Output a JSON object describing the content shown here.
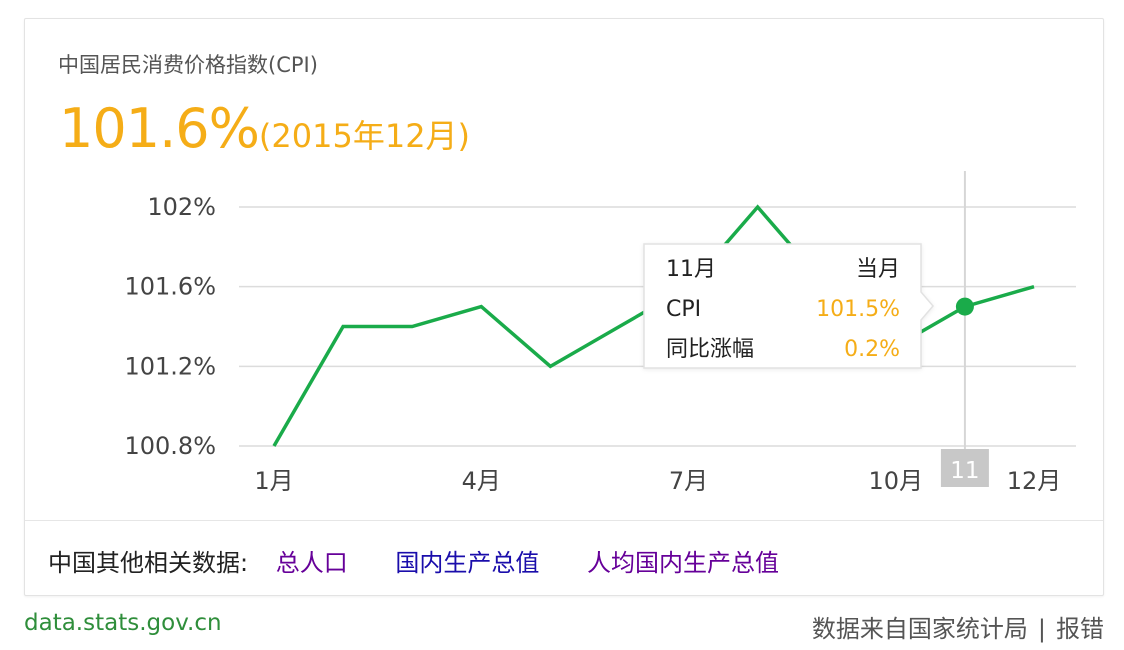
{
  "card": {
    "title": "中国居民消费价格指数(CPI)",
    "headline_value": "101.6%",
    "headline_period": "(2015年12月)"
  },
  "tooltip": {
    "month": "11月",
    "period_label": "当月",
    "rows": [
      {
        "label": "CPI",
        "value": "101.5%"
      },
      {
        "label": "同比涨幅",
        "value": "0.2%"
      }
    ]
  },
  "hover": {
    "index": 10,
    "x_label": "11"
  },
  "footer": {
    "related_label": "中国其他相关数据:",
    "links": [
      "总人口",
      "国内生产总值",
      "人均国内生产总值"
    ]
  },
  "source": {
    "link": "data.stats.gov.cn",
    "credit": "数据来自国家统计局",
    "separator": "|",
    "report": "报错"
  },
  "colors": {
    "accent": "#f5ad17",
    "line": "#1aab4a",
    "grid": "#dcdcdc",
    "link_visited": "#660099",
    "link": "#1a0dab",
    "source_green": "#2f8e3b"
  },
  "chart_data": {
    "type": "line",
    "x": [
      "1月",
      "2月",
      "3月",
      "4月",
      "5月",
      "6月",
      "7月",
      "8月",
      "9月",
      "10月",
      "11月",
      "12月"
    ],
    "x_tick_labels": [
      "1月",
      "4月",
      "7月",
      "10月",
      "12月"
    ],
    "x_tick_indices": [
      0,
      3,
      6,
      9,
      11
    ],
    "y_ticks": [
      100.8,
      101.2,
      101.6,
      102
    ],
    "y_tick_labels": [
      "100.8%",
      "101.2%",
      "101.6%",
      "102%"
    ],
    "ylim": [
      100.8,
      102.0
    ],
    "series": [
      {
        "values": [
          100.8,
          101.4,
          101.4,
          101.5,
          101.2,
          101.4,
          101.6,
          102.0,
          101.6,
          101.3,
          101.5,
          101.6
        ]
      }
    ],
    "grid": true
  }
}
